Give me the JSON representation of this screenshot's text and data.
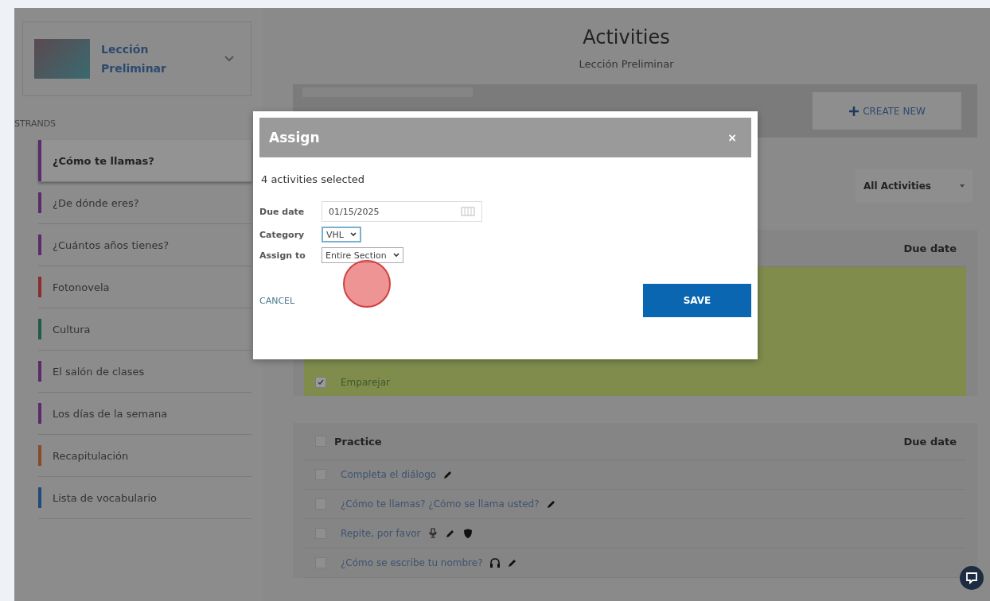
{
  "sidebar": {
    "course": {
      "title": "Lección Preliminar"
    },
    "strands_label": "STRANDS",
    "strands": [
      {
        "label": "¿Cómo te llamas?",
        "color": "#5a2a6a",
        "selected": true
      },
      {
        "label": "¿De dónde eres?",
        "color": "#5a2a6a",
        "selected": false
      },
      {
        "label": "¿Cuántos años tienes?",
        "color": "#5a2a6a",
        "selected": false
      },
      {
        "label": "Fotonovela",
        "color": "#8a2c2c",
        "selected": false
      },
      {
        "label": "Cultura",
        "color": "#1f5a4a",
        "selected": false
      },
      {
        "label": "El salón de clases",
        "color": "#5a2a6a",
        "selected": false
      },
      {
        "label": "Los días de la semana",
        "color": "#5a2a6a",
        "selected": false
      },
      {
        "label": "Recapitulación",
        "color": "#8a4a2a",
        "selected": false
      },
      {
        "label": "Lista de vocabulario",
        "color": "#1f4a7a",
        "selected": false
      }
    ]
  },
  "header": {
    "title": "Activities",
    "subtitle": "Lección Preliminar"
  },
  "toolbar": {
    "create_button": "CREATE NEW",
    "filter": "All Activities"
  },
  "sections": [
    {
      "due_column": "Due date",
      "highlighted": true,
      "rows": [
        {
          "title": "Emparejar",
          "checked": true,
          "icons": []
        }
      ]
    },
    {
      "heading": "Practice",
      "checked": false,
      "due_column": "Due date",
      "highlighted": false,
      "rows": [
        {
          "title": "Completa el diálogo",
          "checked": false,
          "icons": [
            {
              "kind": "pencil"
            }
          ]
        },
        {
          "title": "¿Cómo te llamas? ¿Cómo se llama usted?",
          "checked": false,
          "icons": [
            {
              "kind": "pencil"
            }
          ]
        },
        {
          "title": "Repite, por favor",
          "checked": false,
          "icons": [
            {
              "kind": "microphone"
            },
            {
              "kind": "pencil"
            },
            {
              "kind": "shield"
            }
          ]
        },
        {
          "title": "¿Cómo se escribe tu nombre?",
          "checked": false,
          "icons": [
            {
              "kind": "headphones"
            },
            {
              "kind": "pencil"
            }
          ]
        }
      ]
    }
  ],
  "modal": {
    "title": "Assign",
    "close": "×",
    "summary": "4 activities selected",
    "fields": [
      {
        "kind": "date",
        "label": "Due date",
        "value": "01/15/2025"
      },
      {
        "kind": "select",
        "label": "Category",
        "value": "VHL",
        "focused": true
      },
      {
        "kind": "select",
        "label": "Assign to",
        "value": "Entire Section",
        "focused": false
      }
    ],
    "cancel": "CANCEL",
    "save": "SAVE"
  }
}
